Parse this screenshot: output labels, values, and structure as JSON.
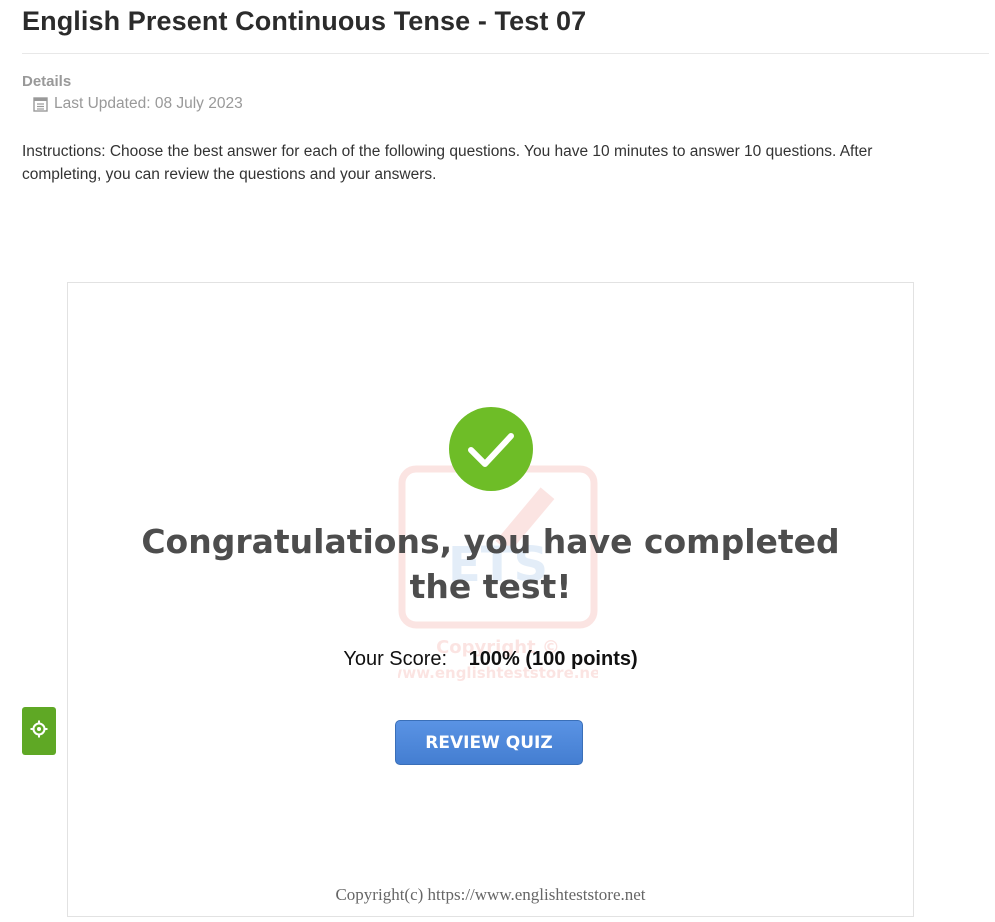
{
  "page": {
    "title": "English Present Continuous Tense - Test 07",
    "details_label": "Details",
    "last_updated": "Last Updated: 08 July 2023",
    "instructions": "Instructions: Choose the best answer for each of the following questions. You have 10 minutes to answer 10 questions. After completing, you can review the questions and your answers."
  },
  "quiz": {
    "congrats_message": "Congratulations, you have completed the test!",
    "score_label": "Your Score:",
    "score_value": "100% (100 points)",
    "review_button_label": "REVIEW QUIZ",
    "footer_copyright": "Copyright(c) https://www.englishteststore.net",
    "watermark_text": "ETS",
    "watermark_copyright": "Copyright ©",
    "watermark_site": "www.englishteststore.net"
  },
  "icons": {
    "calendar": "calendar-icon",
    "check": "checkmark-icon",
    "settings": "gear-icon"
  },
  "colors": {
    "success_green": "#6ebd27",
    "settings_tab_green": "#5fa825",
    "button_blue": "#4a85d8",
    "watermark_red": "#e8352b",
    "watermark_blue": "#2f7bd1"
  }
}
